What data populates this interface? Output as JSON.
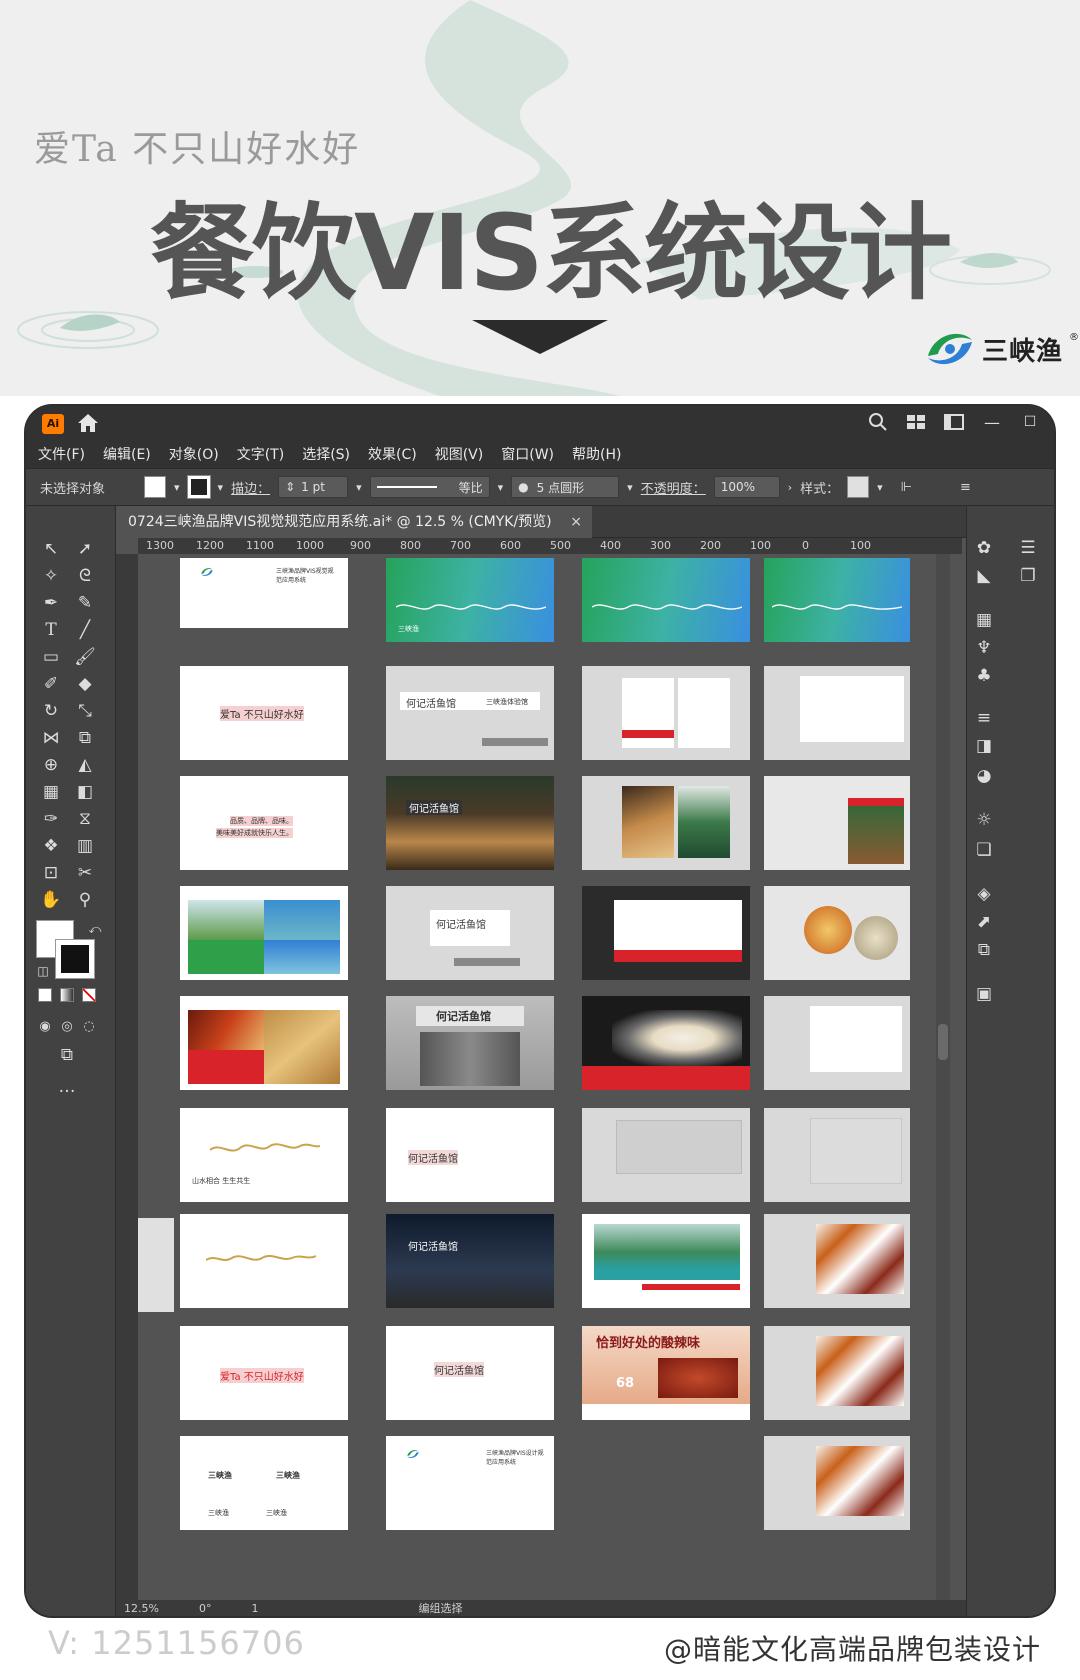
{
  "banner": {
    "tagline": "爱Ta  不只山好水好",
    "headline": "餐饮VIS系统设计",
    "brand_name": "三峡渔",
    "brand_reg": "®"
  },
  "app": {
    "logo": "Ai",
    "menu": [
      "文件(F)",
      "编辑(E)",
      "对象(O)",
      "文字(T)",
      "选择(S)",
      "效果(C)",
      "视图(V)",
      "窗口(W)",
      "帮助(H)"
    ],
    "control": {
      "selection": "未选择对象",
      "stroke_label": "描边：",
      "stroke_value": "1 pt",
      "profile": "等比",
      "brush": "5 点圆形",
      "opacity_label": "不透明度：",
      "opacity_value": "100%",
      "style_label": "样式："
    },
    "doc_tab": "0724三峡渔品牌VIS视觉规范应用系统.ai* @ 12.5 % (CMYK/预览)",
    "ruler_top": [
      "1300",
      "1200",
      "1100",
      "1000",
      "900",
      "800",
      "700",
      "600",
      "500",
      "400",
      "300",
      "200",
      "100",
      "0",
      "100"
    ],
    "status": {
      "zoom": "12.5%",
      "rotation": "0°",
      "artboard": "1",
      "mode": "编组选择"
    },
    "artboards": {
      "col1": [
        {
          "title": "三峡渔品牌VIS视觉规范应用系统"
        },
        {
          "slogan": "爱Ta  不只山好水好"
        },
        {
          "line1": "品质、品牌、品味。",
          "line2": "美味美好成就快乐人生。"
        },
        {},
        {},
        {
          "text": "山水相合  生生共生"
        },
        {},
        {
          "slogan": "爱Ta  不只山好水好"
        },
        {
          "logo1": "三峡渔",
          "logo2": "三峡渔",
          "logo3": "三峡渔",
          "logo4": "三峡渔"
        }
      ],
      "col2": [
        {
          "brand": "三峡渔"
        },
        {
          "store": "何记活鱼馆",
          "brand": "三峡渔体验馆"
        },
        {
          "store": "何记活鱼馆"
        },
        {
          "store": "何记活鱼馆"
        },
        {
          "store": "何记活鱼馆"
        },
        {
          "store": "何记活鱼馆"
        },
        {
          "store": "何记活鱼馆"
        },
        {
          "store": "何记活鱼馆"
        },
        {
          "title": "三峡渔品牌VIS设计规范应用系统"
        }
      ],
      "col3": [
        {},
        {},
        {},
        {},
        {},
        {},
        {},
        {
          "promo": "恰到好处的酸辣味",
          "price": "68"
        }
      ]
    }
  },
  "footer": {
    "contact": "V:  1251156706",
    "credit": "@暗能文化高端品牌包装设计"
  },
  "colors": {
    "accent": "#ff7c00",
    "brand_green": "#1f9a4f",
    "brand_blue": "#2f7fd6",
    "red": "#d8232a"
  }
}
